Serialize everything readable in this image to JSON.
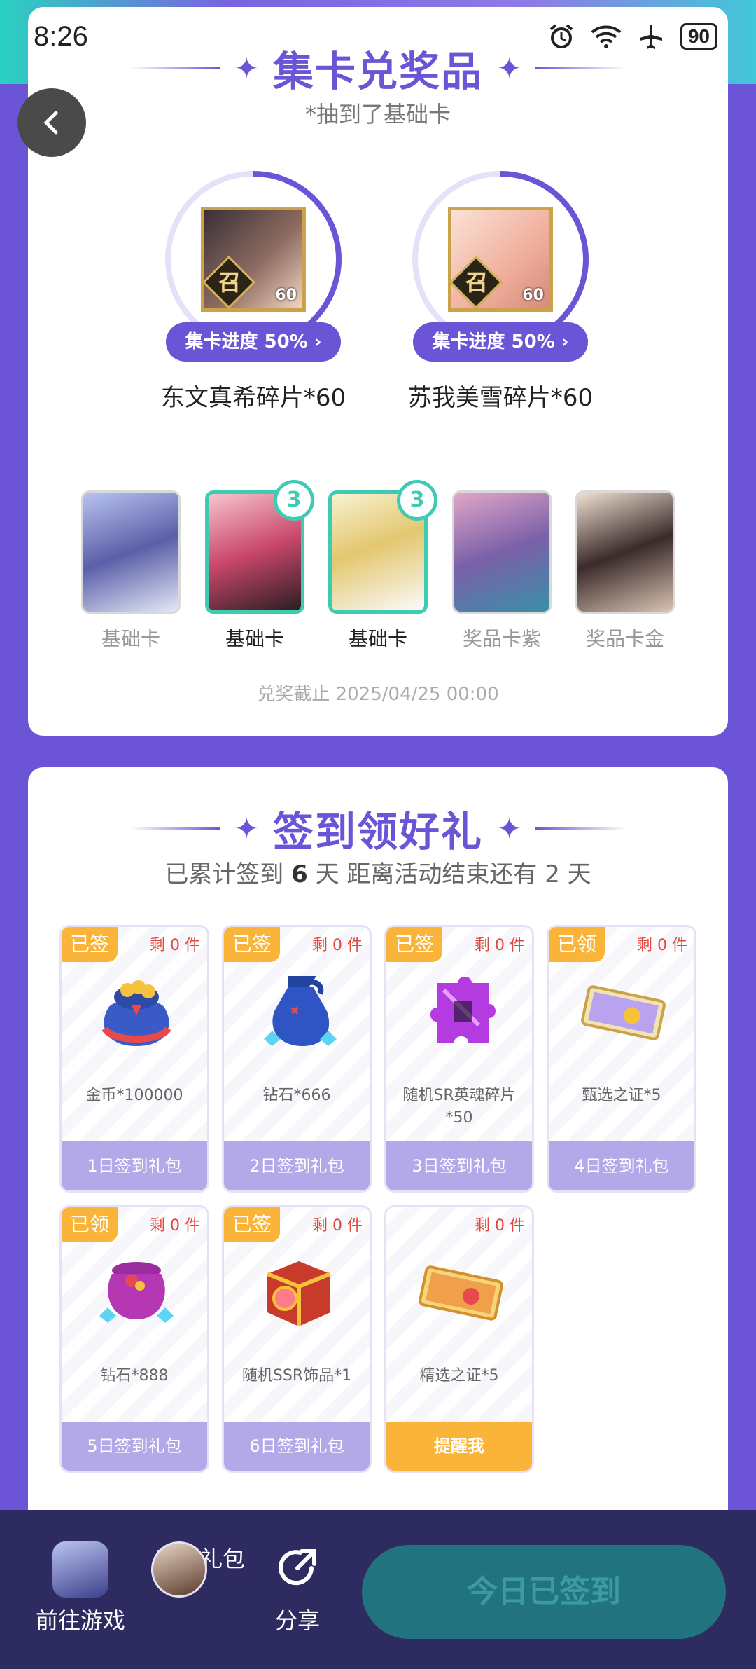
{
  "status_bar": {
    "time": "8:26",
    "battery": "90"
  },
  "collect": {
    "title": "集卡兑奖品",
    "subtitle": "*抽到了基础卡",
    "prizes": [
      {
        "progress_label": "集卡进度 50%",
        "progress": 0.5,
        "name": "东文真希碎片*60",
        "summon": "召",
        "count": "60"
      },
      {
        "progress_label": "集卡进度 50%",
        "progress": 0.5,
        "name": "苏我美雪碎片*60",
        "summon": "召",
        "count": "60"
      }
    ],
    "cards": [
      {
        "label": "基础卡",
        "badge": ""
      },
      {
        "label": "基础卡",
        "badge": "3"
      },
      {
        "label": "基础卡",
        "badge": "3"
      },
      {
        "label": "奖品卡紫",
        "badge": ""
      },
      {
        "label": "奖品卡金",
        "badge": ""
      }
    ],
    "deadline": "兑奖截止 2025/04/25 00:00"
  },
  "signin": {
    "title": "签到领好礼",
    "stats_prefix": "已累计签到",
    "days": "6",
    "stats_mid": "天  距离活动结束还有 2 天",
    "gifts": [
      {
        "tag": "已签",
        "remain": "剩 0 件",
        "name": "金币*100000",
        "footer": "1日签到礼包",
        "icon": "coin-bag-icon"
      },
      {
        "tag": "已签",
        "remain": "剩 0 件",
        "name": "钻石*666",
        "footer": "2日签到礼包",
        "icon": "diamond-bag-icon"
      },
      {
        "tag": "已签",
        "remain": "剩 0 件",
        "name": "随机SR英魂碎片*50",
        "footer": "3日签到礼包",
        "icon": "puzzle-shard-icon"
      },
      {
        "tag": "已领",
        "remain": "剩 0 件",
        "name": "甄选之证*5",
        "footer": "4日签到礼包",
        "icon": "ticket-icon"
      },
      {
        "tag": "已领",
        "remain": "剩 0 件",
        "name": "钻石*888",
        "footer": "5日签到礼包",
        "icon": "diamond-pouch-icon"
      },
      {
        "tag": "已签",
        "remain": "剩 0 件",
        "name": "随机SSR饰品*1",
        "footer": "6日签到礼包",
        "icon": "treasure-box-icon"
      },
      {
        "tag": "",
        "remain": "剩 0 件",
        "name": "精选之证*5",
        "footer": "提醒我",
        "icon": "gold-ticket-icon"
      }
    ]
  },
  "bottom_bar": {
    "game_label": "前往游戏",
    "gift_label": "我的礼包",
    "share_label": "分享",
    "signed_label": "今日已签到"
  }
}
